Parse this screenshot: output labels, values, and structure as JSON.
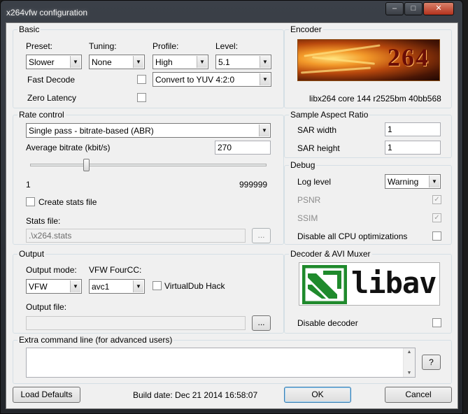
{
  "window": {
    "title": "x264vfw configuration",
    "caption_buttons": {
      "minimize": "–",
      "maximize": "□",
      "close": "✕"
    }
  },
  "basic": {
    "group_title": "Basic",
    "preset_label": "Preset:",
    "preset_value": "Slower",
    "tuning_label": "Tuning:",
    "tuning_value": "None",
    "profile_label": "Profile:",
    "profile_value": "High",
    "level_label": "Level:",
    "level_value": "5.1",
    "fast_decode_label": "Fast Decode",
    "fast_decode_checked": false,
    "colorspace_value": "Convert to YUV 4:2:0",
    "zero_latency_label": "Zero Latency",
    "zero_latency_checked": false
  },
  "encoder": {
    "group_title": "Encoder",
    "logo_text": "264",
    "version": "libx264 core 144 r2525bm 40bb568"
  },
  "rate_control": {
    "group_title": "Rate control",
    "mode_value": "Single pass - bitrate-based (ABR)",
    "bitrate_label": "Average bitrate (kbit/s)",
    "bitrate_value": "270",
    "slider_min": "1",
    "slider_max": "999999",
    "slider_fraction": 0.23,
    "create_stats_label": "Create stats file",
    "create_stats_checked": false,
    "stats_file_label": "Stats file:",
    "stats_file_value": ".\\x264.stats",
    "browse_label": "..."
  },
  "sar": {
    "group_title": "Sample Aspect Ratio",
    "width_label": "SAR width",
    "width_value": "1",
    "height_label": "SAR height",
    "height_value": "1"
  },
  "debug": {
    "group_title": "Debug",
    "log_level_label": "Log level",
    "log_level_value": "Warning",
    "psnr_label": "PSNR",
    "psnr_checked": true,
    "ssim_label": "SSIM",
    "ssim_checked": true,
    "disable_cpu_label": "Disable all CPU optimizations",
    "disable_cpu_checked": false,
    "check_mark": "✓"
  },
  "output": {
    "group_title": "Output",
    "mode_label": "Output mode:",
    "mode_value": "VFW",
    "fourcc_label": "VFW FourCC:",
    "fourcc_value": "avc1",
    "virtualdub_label": "VirtualDub Hack",
    "virtualdub_checked": false,
    "file_label": "Output file:",
    "file_value": "",
    "browse_label": "..."
  },
  "decoder": {
    "group_title": "Decoder & AVI Muxer",
    "logo_text": "libav",
    "disable_decoder_label": "Disable decoder",
    "disable_decoder_checked": false
  },
  "extra": {
    "group_title": "Extra command line (for advanced users)",
    "value": "",
    "help_label": "?"
  },
  "footer": {
    "load_defaults_label": "Load Defaults",
    "build_date": "Build date: Dec 21 2014 16:58:07",
    "ok_label": "OK",
    "cancel_label": "Cancel"
  },
  "colors": {
    "dialog_background": "#f0f0f0",
    "title_bar": "#30343a",
    "close_button": "#c23a22",
    "libav_green": "#1f8a2c"
  }
}
